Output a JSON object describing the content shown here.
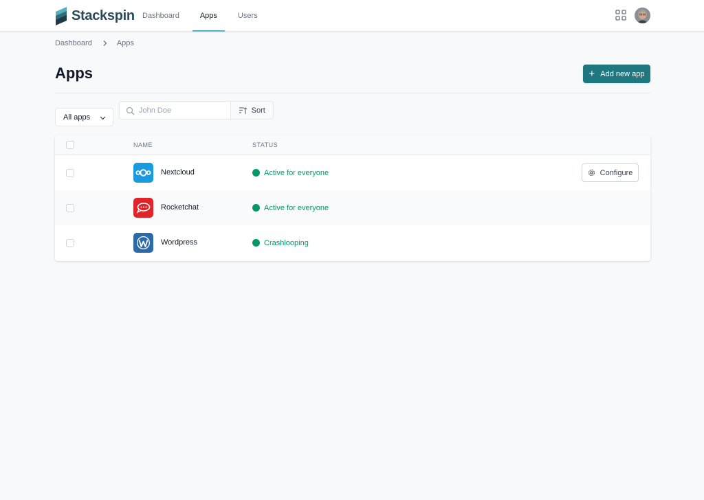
{
  "brand": {
    "name": "Stackspin",
    "accent_color": "#1f7780"
  },
  "nav": {
    "items": [
      {
        "label": "Dashboard",
        "active": false
      },
      {
        "label": "Apps",
        "active": true
      },
      {
        "label": "Users",
        "active": false
      }
    ]
  },
  "header_icons": {
    "apps_grid": "grid-icon",
    "avatar": "user-avatar"
  },
  "breadcrumb": {
    "items": [
      "Dashboard",
      "Apps"
    ],
    "separator_icon": "chevron-right-icon"
  },
  "page": {
    "title": "Apps",
    "add_button_label": "Add new app",
    "add_button_icon": "plus-icon"
  },
  "filters": {
    "select_value": "All apps",
    "search_placeholder": "John Doe",
    "sort_label": "Sort"
  },
  "table": {
    "columns": [
      "NAME",
      "STATUS"
    ],
    "rows": [
      {
        "name": "Nextcloud",
        "status": "Active for everyone",
        "icon": "nextcloud-icon",
        "action": "Configure"
      },
      {
        "name": "Rocketchat",
        "status": "Active for everyone",
        "icon": "rocketchat-icon",
        "action": ""
      },
      {
        "name": "Wordpress",
        "status": "Crashlooping",
        "icon": "wordpress-icon",
        "action": ""
      }
    ]
  },
  "colors": {
    "status_green": "#059669",
    "nav_indicator": "#54b1c1"
  }
}
